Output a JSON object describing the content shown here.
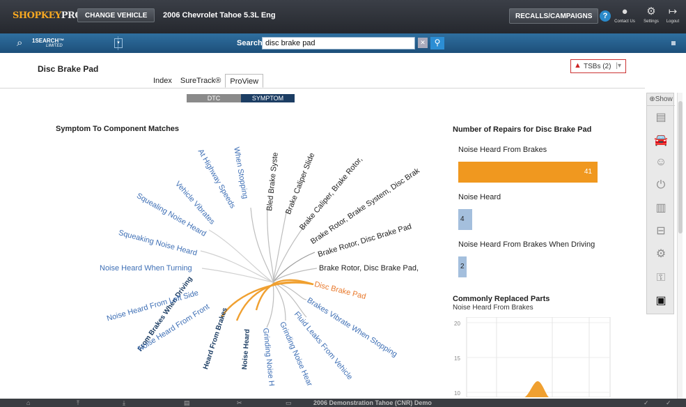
{
  "topbar": {
    "logo_a": "SHOPKEY",
    "logo_b": "PRO",
    "change_vehicle": "CHANGE VEHICLE",
    "vehicle": "2006 Chevrolet Tahoe 5.3L Eng",
    "recalls": "RECALLS/CAMPAIGNS",
    "help": "?",
    "contact": "Contact Us",
    "settings": "Settings",
    "logout": "Logout"
  },
  "searchbar": {
    "onesearch": "1SEARCH™",
    "limited": "LIMITED",
    "label": "Search",
    "value": "disc brake pad"
  },
  "page": {
    "title": "Disc Brake Pad",
    "tabs": [
      "Index",
      "SureTrack®",
      "ProView"
    ],
    "active_tab": "ProView",
    "tsb": "TSBs (2)",
    "toggle": [
      "DTC",
      "SYMPTOM"
    ],
    "active_toggle": "SYMPTOM"
  },
  "chord": {
    "title": "Symptom To Component Matches",
    "left_labels": [
      "From Brakes When Driving",
      "Heard From Brakes",
      "Noise Heard",
      "Noise Heard From Front",
      "Noise Heard From Left Side",
      "Noise Heard When Turning",
      "Squeaking Noise Heard",
      "Squealing Noise Heard",
      "Vehicle Vibrates",
      "At Highway Speeds",
      "When Stopping"
    ],
    "top_labels": [
      "Bled Brake Syste",
      "Brake Caliper Slide",
      "Brake Caliper, Brake Rotor,",
      "Brake Rotor, Brake System, Disc Brak",
      "Brake Rotor, Disc Brake Pad",
      "Brake Rotor, Disc Brake Pad,"
    ],
    "highlight_label": "Disc Brake Pad",
    "right_labels": [
      "Brakes Vibrate When Stopping",
      "Fluid Leaks From Vehicle",
      "Grinding Noise Hear",
      "Grinding Noise H"
    ],
    "colors": {
      "highlight": "#f0a030",
      "symptom": "#3e6fb5",
      "component": "#222222",
      "link": "#bdbdbd"
    }
  },
  "repairs": {
    "title": "Number of Repairs for Disc Brake Pad",
    "items": [
      {
        "label": "Noise Heard From Brakes",
        "value": 41
      },
      {
        "label": "Noise Heard",
        "value": 4
      },
      {
        "label": "Noise Heard From Brakes When Driving",
        "value": 2
      }
    ]
  },
  "parts": {
    "title": "Commonly Replaced Parts",
    "subtitle": "Noise Heard From Brakes"
  },
  "chart_data": {
    "type": "bar",
    "title": "Number of Repairs for Disc Brake Pad",
    "categories": [
      "Noise Heard From Brakes",
      "Noise Heard",
      "Noise Heard From Brakes When Driving"
    ],
    "values": [
      41,
      4,
      2
    ],
    "xlabel": "",
    "ylabel": "",
    "ylim": [
      0,
      41
    ]
  },
  "parts_axis": {
    "ticks": [
      20,
      15,
      10
    ]
  },
  "sidebar": {
    "show": "Show",
    "icons": [
      "document-icon",
      "car-icon",
      "user-icon",
      "power-icon",
      "book-icon",
      "component-icon",
      "engine-icon",
      "key-icon",
      "tsb-icon"
    ]
  },
  "bottombar": {
    "vehicle": "2006 Demonstration Tahoe (CNR) Demo"
  }
}
